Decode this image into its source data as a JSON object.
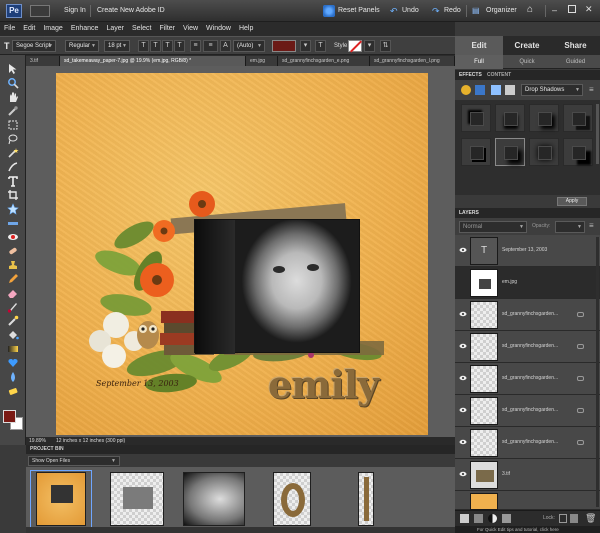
{
  "topbar": {
    "sign_in": "Sign In",
    "create_id": "Create New Adobe ID",
    "reset_panels": "Reset Panels",
    "undo": "Undo",
    "redo": "Redo",
    "organizer": "Organizer"
  },
  "menu": [
    "File",
    "Edit",
    "Image",
    "Enhance",
    "Layer",
    "Select",
    "Filter",
    "View",
    "Window",
    "Help"
  ],
  "options": {
    "font_family": "Segoe Script",
    "font_style": "Regular",
    "font_size": "18 pt",
    "leading": "(Auto)",
    "style_label": "Style:",
    "text_color": "#6b1a16"
  },
  "modes": {
    "tabs": [
      "Edit",
      "Create",
      "Share"
    ],
    "active": "Edit",
    "subtabs": [
      "Full",
      "Quick",
      "Guided"
    ],
    "active_subtab": "Full"
  },
  "doc_tabs": [
    {
      "label": "3.tif",
      "active": false
    },
    {
      "label": "sd_takemeaway_paper-7.jpg @ 19.9% (em.jpg, RGB/8) *",
      "active": true
    },
    {
      "label": "em.jpg",
      "active": false
    },
    {
      "label": "sd_grannyfinchsgarden_e.png",
      "active": false
    },
    {
      "label": "sd_grannyfinchsgarden_l.png",
      "active": false
    }
  ],
  "canvas": {
    "date_text": "September 13, 2003",
    "title_word": "emily"
  },
  "status": {
    "zoom": "19.89%",
    "doc_size": "12 inches x 12 inches (300 ppi)"
  },
  "project_bin": {
    "header": "PROJECT BIN",
    "show": "Show Open Files"
  },
  "effects": {
    "header_tabs": [
      "EFFECTS",
      "CONTENT"
    ],
    "category": "Drop Shadows",
    "apply": "Apply"
  },
  "layers": {
    "header": "LAYERS",
    "blend_mode": "Normal",
    "opacity_label": "Opacity:",
    "lock_label": "Lock:",
    "items": [
      {
        "name": "September 13, 2003",
        "visible": true,
        "type": "text",
        "selected": false
      },
      {
        "name": "em.jpg",
        "visible": false,
        "type": "photo",
        "selected": true
      },
      {
        "name": "sd_grannyfinchsgarden...",
        "visible": true,
        "type": "checker",
        "selected": false
      },
      {
        "name": "sd_grannyfinchsgarden...",
        "visible": true,
        "type": "checker",
        "selected": false
      },
      {
        "name": "sd_grannyfinchsgarden...",
        "visible": true,
        "type": "checker",
        "selected": false
      },
      {
        "name": "sd_grannyfinchsgarden...",
        "visible": true,
        "type": "checker",
        "selected": false
      },
      {
        "name": "sd_grannyfinchsgarden...",
        "visible": true,
        "type": "checker",
        "selected": false
      },
      {
        "name": "3.tif",
        "visible": true,
        "type": "scrap",
        "selected": false
      }
    ]
  },
  "tip": "For Quick Edit tips and tutorial, click here"
}
